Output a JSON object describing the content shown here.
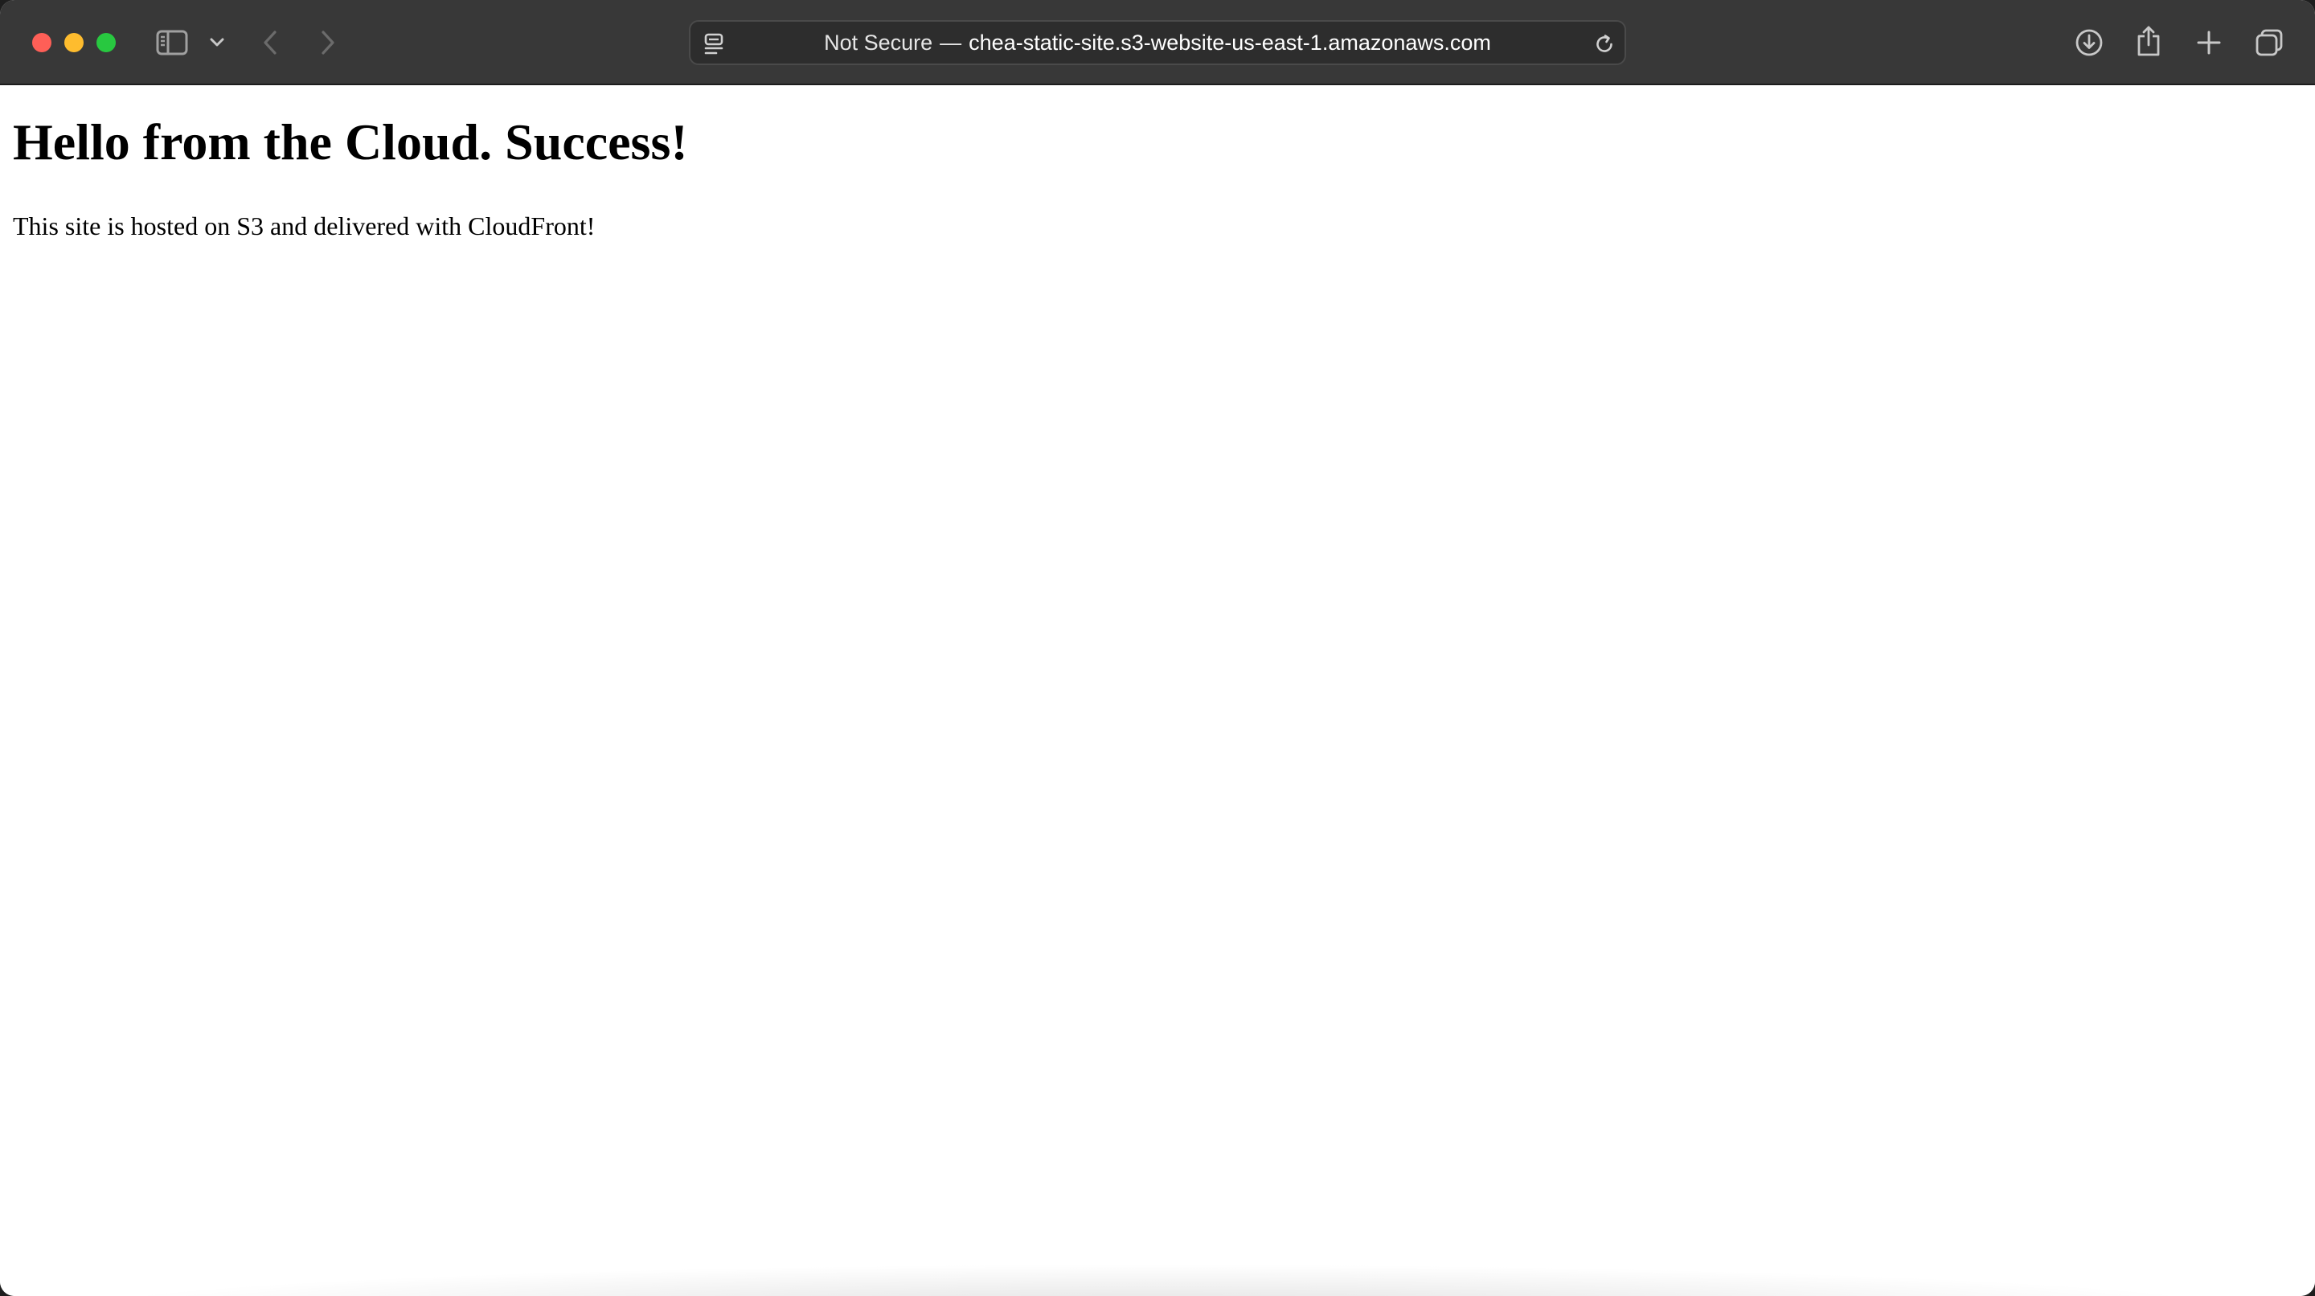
{
  "browser": {
    "address_bar": {
      "security_label": "Not Secure",
      "separator": "—",
      "host": "chea-static-site.s3-website-us-east-1.amazonaws.com"
    },
    "icons": {
      "close": "close-window-icon",
      "minimize": "minimize-window-icon",
      "maximize": "fullscreen-window-icon",
      "sidebar": "sidebar-icon",
      "sidebar_menu": "chevron-down-icon",
      "back": "chevron-left-icon",
      "forward": "chevron-right-icon",
      "page_menu": "page-menu-icon",
      "reload": "reload-icon",
      "downloads": "download-icon",
      "share": "share-icon",
      "new_tab": "plus-icon",
      "tab_overview": "tab-overview-icon"
    },
    "colors": {
      "toolbar": "#383838",
      "close": "#fe5f57",
      "minimize": "#febc2e",
      "maximize": "#28c840"
    }
  },
  "page": {
    "heading": "Hello from the Cloud. Success!",
    "body": "This site is hosted on S3 and delivered with CloudFront!"
  }
}
